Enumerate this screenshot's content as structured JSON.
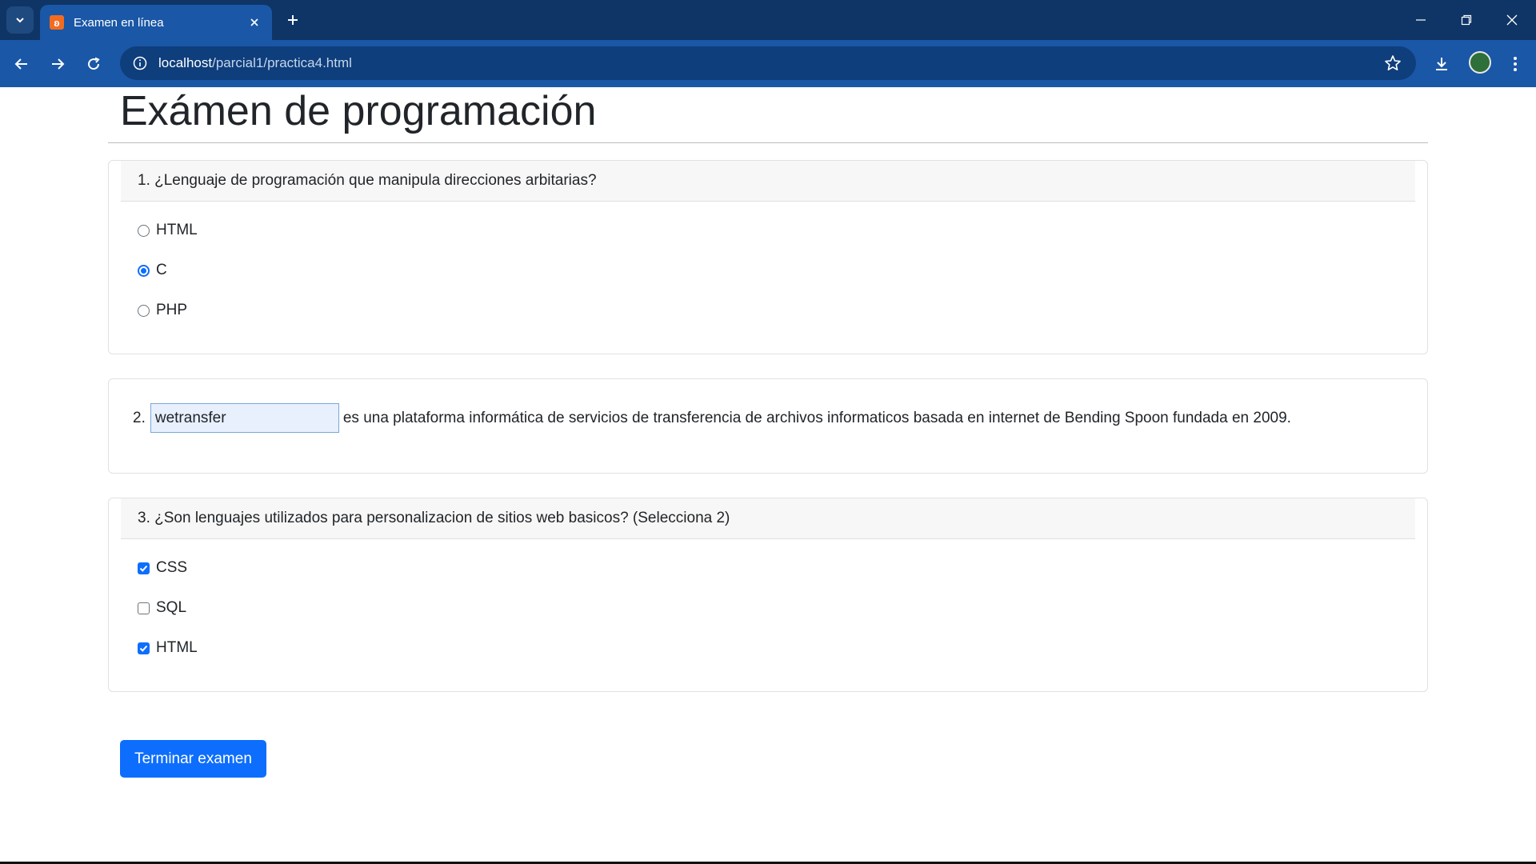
{
  "browser": {
    "tab_title": "Examen en línea",
    "favicon_glyph": "ʚ",
    "url_host": "localhost",
    "url_path": "/parcial1/practica4.html"
  },
  "page": {
    "title": "Exámen de programación",
    "q1": {
      "header": "1. ¿Lenguaje de programación que manipula direcciones arbitarias?",
      "options": [
        {
          "label": "HTML",
          "checked": false
        },
        {
          "label": "C",
          "checked": true
        },
        {
          "label": "PHP",
          "checked": false
        }
      ]
    },
    "q2": {
      "number": "2.",
      "answer_value": "wetransfer",
      "sentence": "es una plataforma informática de servicios de transferencia de archivos informaticos basada en internet de Bending Spoon fundada en 2009."
    },
    "q3": {
      "header": "3. ¿Son lenguajes utilizados para personalizacion de sitios web basicos? (Selecciona 2)",
      "options": [
        {
          "label": "CSS",
          "checked": true
        },
        {
          "label": "SQL",
          "checked": false
        },
        {
          "label": "HTML",
          "checked": true
        }
      ]
    },
    "submit_label": "Terminar examen"
  },
  "colors": {
    "chrome_dark": "#0f3566",
    "chrome_toolbar": "#1a57a6",
    "primary": "#0d6efd"
  }
}
